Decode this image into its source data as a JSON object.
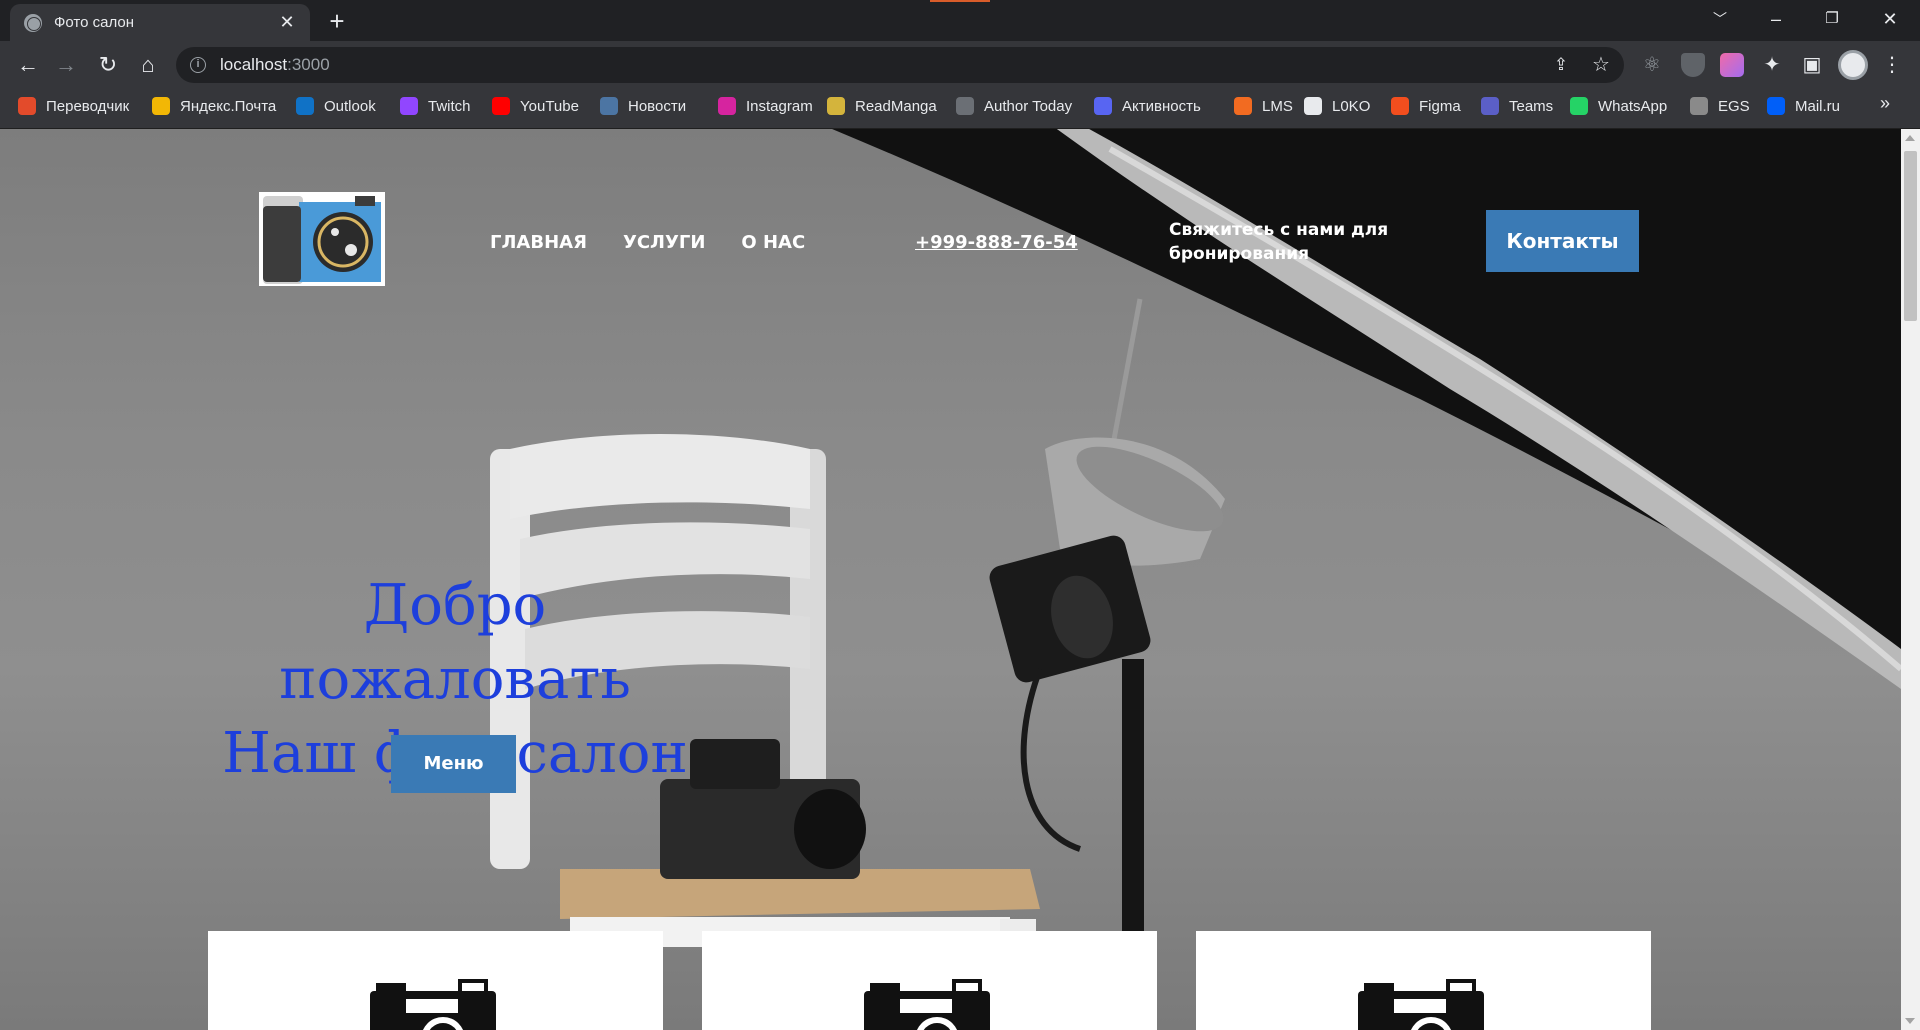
{
  "browser": {
    "tab_title": "Фото салон",
    "tab_close": "✕",
    "new_tab": "+",
    "url_host": "localhost",
    "url_port": ":3000",
    "bookmarks": [
      {
        "label": "Переводчик",
        "icon": "translate-icon",
        "color": "#e34b2b"
      },
      {
        "label": "Яндекс.Почта",
        "icon": "mail-icon",
        "color": "#f2b705"
      },
      {
        "label": "Outlook",
        "icon": "outlook-icon",
        "color": "#1072c6"
      },
      {
        "label": "Twitch",
        "icon": "twitch-icon",
        "color": "#9146ff"
      },
      {
        "label": "YouTube",
        "icon": "youtube-icon",
        "color": "#ff0000"
      },
      {
        "label": "Новости",
        "icon": "vk-icon",
        "color": "#4c75a3"
      },
      {
        "label": "Instagram",
        "icon": "instagram-icon",
        "color": "#d6249f"
      },
      {
        "label": "ReadManga",
        "icon": "readmanga-icon",
        "color": "#d4b43c"
      },
      {
        "label": "Author Today",
        "icon": "author-today-icon",
        "color": "#6b6f75"
      },
      {
        "label": "Активность",
        "icon": "discord-icon",
        "color": "#5865f2"
      },
      {
        "label": "LMS",
        "icon": "lms-icon",
        "color": "#f26b21"
      },
      {
        "label": "L0KO",
        "icon": "github-icon",
        "color": "#e8eaed"
      },
      {
        "label": "Figma",
        "icon": "figma-icon",
        "color": "#f24e1e"
      },
      {
        "label": "Teams",
        "icon": "teams-icon",
        "color": "#5b5fc7"
      },
      {
        "label": "WhatsApp",
        "icon": "whatsapp-icon",
        "color": "#25d366"
      },
      {
        "label": "EGS",
        "icon": "egs-icon",
        "color": "#8a8a8a"
      },
      {
        "label": "Mail.ru",
        "icon": "mailru-icon",
        "color": "#005ff9"
      }
    ],
    "bookmarks_more": "»"
  },
  "site": {
    "nav": [
      "ГЛАВНАЯ",
      "УСЛУГИ",
      "О НАС"
    ],
    "phone": "+999-888-76-54",
    "cta_text": "Свяжитесь с нами для бронирования",
    "contacts_button": "Контакты",
    "hero_line1": "Добро пожаловать",
    "hero_line2": "Наш фотосалон",
    "menu_button": "Меню"
  },
  "colors": {
    "accent_button": "#3a7ab5",
    "hero_text": "#1d3fdc",
    "logo_bg": "#4a9ad8"
  }
}
